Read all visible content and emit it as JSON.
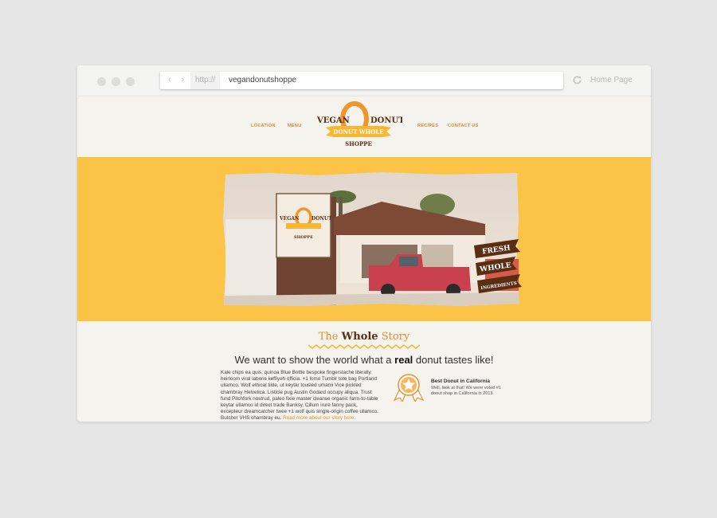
{
  "browser": {
    "protocol": "http://",
    "url": "vegandonutshoppe",
    "home_label": "Home Page"
  },
  "site": {
    "nav": [
      "LOCATION",
      "MENU",
      "RECIPES",
      "CONTACT US"
    ],
    "logo": {
      "line1_left": "VEGAN",
      "line1_right": "DONUT",
      "ribbon": "DONUT WHOLE",
      "line3": "SHOPPE"
    },
    "photo_sign": {
      "left": "VEGAN",
      "right": "DONUT",
      "bottom": "SHOPPE"
    },
    "banner": [
      "FRESH",
      "WHOLE",
      "INGREDIENTS"
    ],
    "story": {
      "title_pre": "The ",
      "title_bold": "Whole",
      "title_post": " Story",
      "tagline_pre": "We want to show the world what a ",
      "tagline_bold": "real",
      "tagline_post": " donut tastes like!",
      "body": "Kale chips ea quis, quinoa Blue Bottle bespoke fingerstache literally heirloom viral laboris keffiyeh officia. +1 lomo Tumblr tote bag Portland ullamco. Wolf ethical tilde, ut keytar tousled umami Vice pickled chambray Helvetica. Listicle pug Austin Godard occupy aliqua. Trust fund Pitchfork nostrud, paleo fixie master cleanse organic farm-to-table keytar ullamco id direct trade Banksy. Cillum irure fanny pack, excepteur dreamcatcher twee +1 wolf quis single-origin coffee ullamco. Butcher VHS chambray eu.",
      "read_more": "Read more about our story here."
    },
    "award": {
      "title": "Best Donut in California",
      "text": "Well, look at that! We were voted #1 donut shop in California in 2013."
    }
  },
  "colors": {
    "accent_orange": "#e8922e",
    "hero_yellow": "#fcc447",
    "brown": "#5a2e13"
  }
}
